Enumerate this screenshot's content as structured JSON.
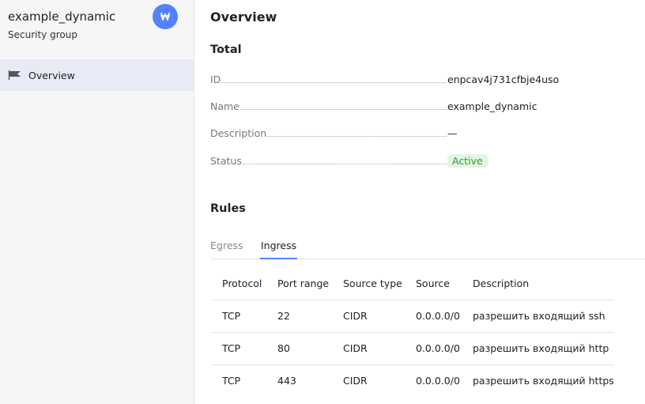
{
  "sidebar": {
    "title": "example_dynamic",
    "subtitle": "Security group",
    "badge_icon": "vpc-icon",
    "accent_color": "#5282ff",
    "items": [
      {
        "label": "Overview",
        "icon": "flag-icon",
        "active": true
      }
    ]
  },
  "main": {
    "title": "Overview",
    "total": {
      "heading": "Total",
      "fields": [
        {
          "key": "ID",
          "value": "enpcav4j731cfbje4uso"
        },
        {
          "key": "Name",
          "value": "example_dynamic"
        },
        {
          "key": "Description",
          "value": "—"
        },
        {
          "key": "Status",
          "value": "Active"
        }
      ]
    },
    "rules": {
      "heading": "Rules",
      "tabs": [
        {
          "label": "Egress",
          "active": false
        },
        {
          "label": "Ingress",
          "active": true
        }
      ],
      "columns": [
        "Protocol",
        "Port range",
        "Source type",
        "Source",
        "Description"
      ],
      "rows": [
        [
          "TCP",
          "22",
          "CIDR",
          "0.0.0.0/0",
          "разрешить входящий ssh"
        ],
        [
          "TCP",
          "80",
          "CIDR",
          "0.0.0.0/0",
          "разрешить входящий http"
        ],
        [
          "TCP",
          "443",
          "CIDR",
          "0.0.0.0/0",
          "разрешить входящий https"
        ]
      ]
    }
  }
}
